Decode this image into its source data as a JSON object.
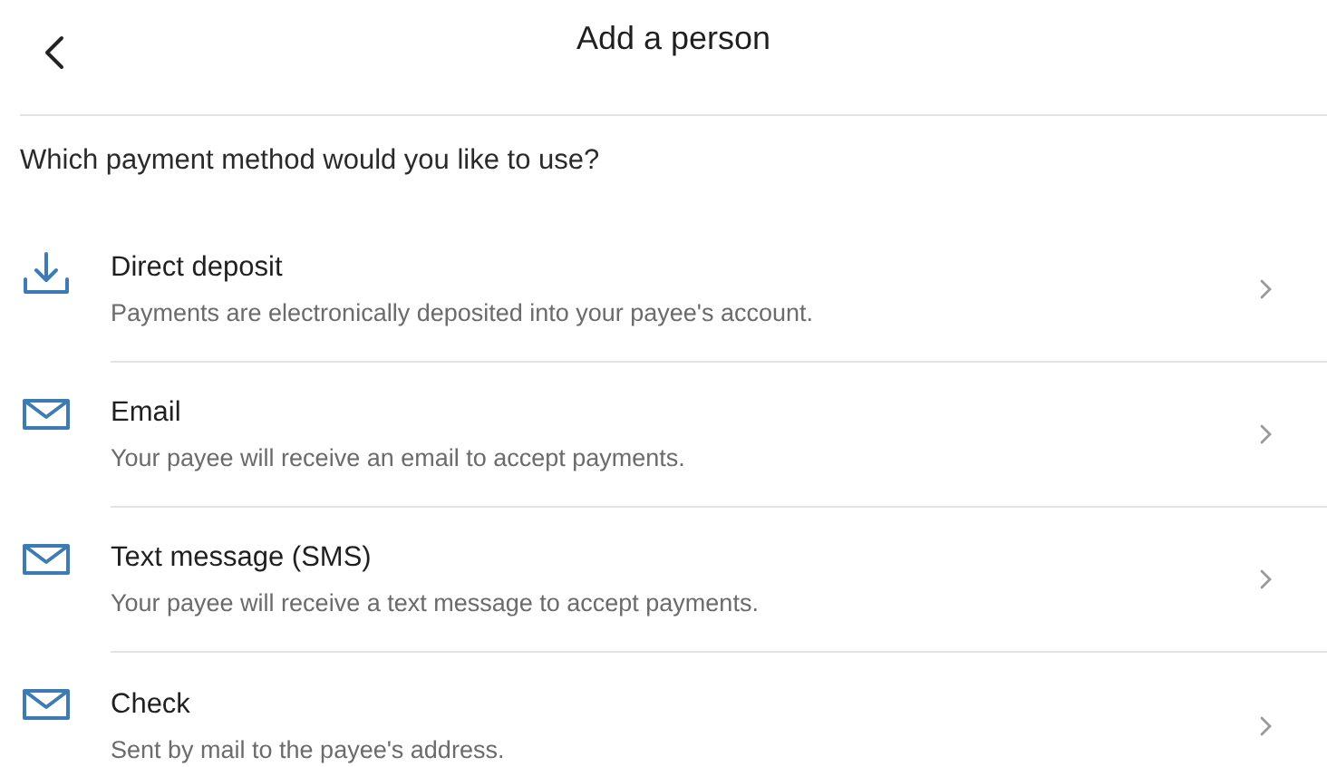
{
  "header": {
    "title": "Add a person"
  },
  "question": "Which payment method would you like to use?",
  "methods": [
    {
      "kind": "deposit",
      "title": "Direct deposit",
      "description": "Payments are electronically deposited into your payee's account."
    },
    {
      "kind": "mail",
      "title": "Email",
      "description": "Your payee will receive an email to accept payments."
    },
    {
      "kind": "mail",
      "title": "Text message (SMS)",
      "description": "Your payee will receive a text message to accept payments."
    },
    {
      "kind": "mail",
      "title": "Check",
      "description": "Sent by mail to the payee's address."
    }
  ]
}
